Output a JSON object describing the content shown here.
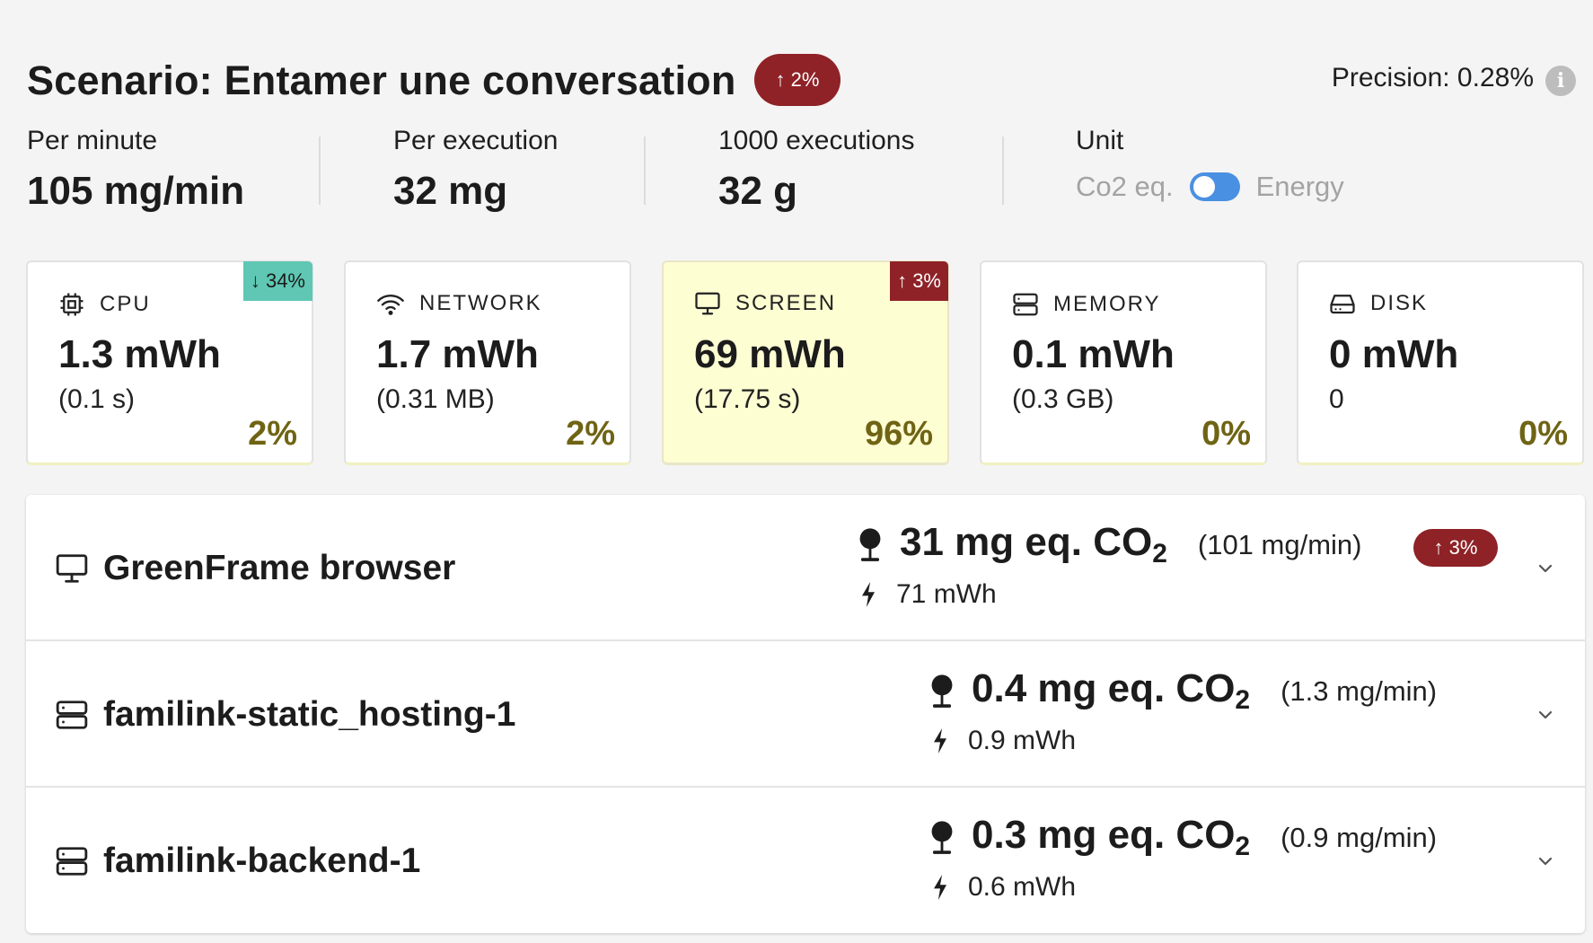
{
  "header": {
    "title": "Scenario: Entamer une conversation",
    "trend_badge": "↑ 2%",
    "precision": "Precision: 0.28%",
    "info_glyph": "i"
  },
  "stats": [
    {
      "label": "Per minute",
      "value": "105 mg/min"
    },
    {
      "label": "Per execution",
      "value": "32 mg"
    },
    {
      "label": "1000 executions",
      "value": "32 g"
    }
  ],
  "unit": {
    "label": "Unit",
    "left_option": "Co2 eq.",
    "right_option": "Energy"
  },
  "cards": [
    {
      "label": "CPU",
      "value": "1.3 mWh",
      "detail": "(0.1 s)",
      "percent": "2%",
      "badge": "↓ 34%",
      "icon": "cpu-icon"
    },
    {
      "label": "NETWORK",
      "value": "1.7 mWh",
      "detail": "(0.31 MB)",
      "percent": "2%",
      "icon": "wifi-icon"
    },
    {
      "label": "SCREEN",
      "value": "69 mWh",
      "detail": "(17.75 s)",
      "percent": "96%",
      "badge": "↑ 3%",
      "icon": "monitor-icon"
    },
    {
      "label": "MEMORY",
      "value": "0.1 mWh",
      "detail": "(0.3 GB)",
      "percent": "0%",
      "icon": "memory-icon"
    },
    {
      "label": "DISK",
      "value": "0 mWh",
      "detail": "0",
      "percent": "0%",
      "icon": "disk-icon"
    }
  ],
  "containers": [
    {
      "name": "GreenFrame browser",
      "co2": "31 mg eq. CO",
      "co2_sub": "2",
      "rate": "(101 mg/min)",
      "energy": "71 mWh",
      "badge": "↑ 3%",
      "icon": "monitor-icon"
    },
    {
      "name": "familink-static_hosting-1",
      "co2": "0.4 mg eq. CO",
      "co2_sub": "2",
      "rate": "(1.3 mg/min)",
      "energy": "0.9 mWh",
      "icon": "server-icon"
    },
    {
      "name": "familink-backend-1",
      "co2": "0.3 mg eq. CO",
      "co2_sub": "2",
      "rate": "(0.9 mg/min)",
      "energy": "0.6 mWh",
      "icon": "server-icon"
    }
  ],
  "colors": {
    "badge_red": "#8e2227",
    "badge_teal": "#5fc7b3",
    "toggle_blue": "#4a90e2",
    "percent_olive": "#6f6414",
    "highlight_yellow": "#fefed3"
  }
}
